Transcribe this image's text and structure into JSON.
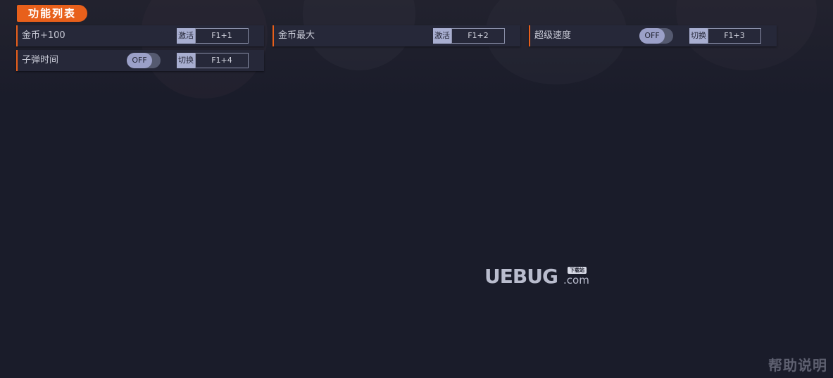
{
  "section": {
    "title": "功能列表"
  },
  "cheats": [
    {
      "label": "金币+100",
      "action": "激活",
      "hotkey": "F1+1"
    },
    {
      "label": "金币最大",
      "action": "激活",
      "hotkey": "F1+2"
    },
    {
      "label": "超级速度",
      "toggle": "OFF",
      "action": "切换",
      "hotkey": "F1+3"
    },
    {
      "label": "子弹时间",
      "toggle": "OFF",
      "action": "切换",
      "hotkey": "F1+4"
    }
  ],
  "watermark": {
    "logo_text": "UEBUG",
    "domain": ".com",
    "badge": "下载站"
  },
  "help": {
    "label": "帮助说明"
  },
  "colors": {
    "accent": "#e8601b",
    "background": "#1a1c2a",
    "row_bg": "#262839",
    "toggle_knob": "#9ba0c8",
    "action_tag": "#a8aed0"
  }
}
